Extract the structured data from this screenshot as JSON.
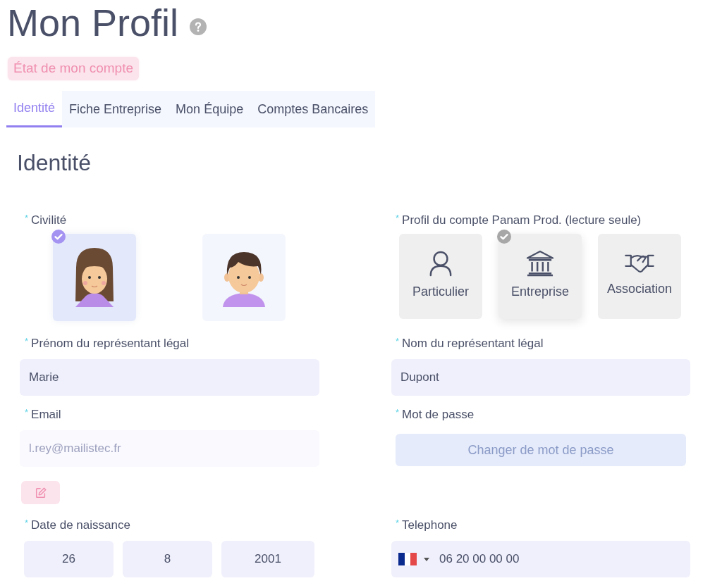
{
  "page_title": "Mon Profil",
  "account_status_button": "État de mon compte",
  "tabs": [
    {
      "label": "Identité",
      "selected": true
    },
    {
      "label": "Fiche Entreprise",
      "selected": false
    },
    {
      "label": "Mon Équipe",
      "selected": false
    },
    {
      "label": "Comptes Bancaires",
      "selected": false
    }
  ],
  "section_title": "Identité",
  "civility": {
    "mark": "*",
    "label": "Civilité",
    "options": [
      {
        "kind": "female",
        "selected": true
      },
      {
        "kind": "male",
        "selected": false
      }
    ]
  },
  "account_profile": {
    "mark": "*",
    "label": "Profil du compte Panam Prod. (lecture seule)",
    "options": [
      {
        "kind": "person",
        "label": "Particulier",
        "selected": false
      },
      {
        "kind": "institution",
        "label": "Entreprise",
        "selected": true
      },
      {
        "kind": "handshake",
        "label": "Association",
        "selected": false
      }
    ]
  },
  "first_name": {
    "mark": "*",
    "label": "Prénom du représentant légal",
    "value": "Marie"
  },
  "last_name": {
    "mark": "*",
    "label": "Nom du représentant légal",
    "value": "Dupont"
  },
  "email": {
    "mark": "*",
    "label": "Email",
    "value": "l.rey@mailistec.fr",
    "disabled": true
  },
  "password": {
    "mark": "*",
    "label": "Mot de passe",
    "button": "Changer de mot de passe"
  },
  "birth_date": {
    "mark": "*",
    "label": "Date de naissance",
    "day": "26",
    "month": "8",
    "year": "2001"
  },
  "phone": {
    "mark": "*",
    "label": "Telephone",
    "value": "06 20 00 00 00"
  }
}
